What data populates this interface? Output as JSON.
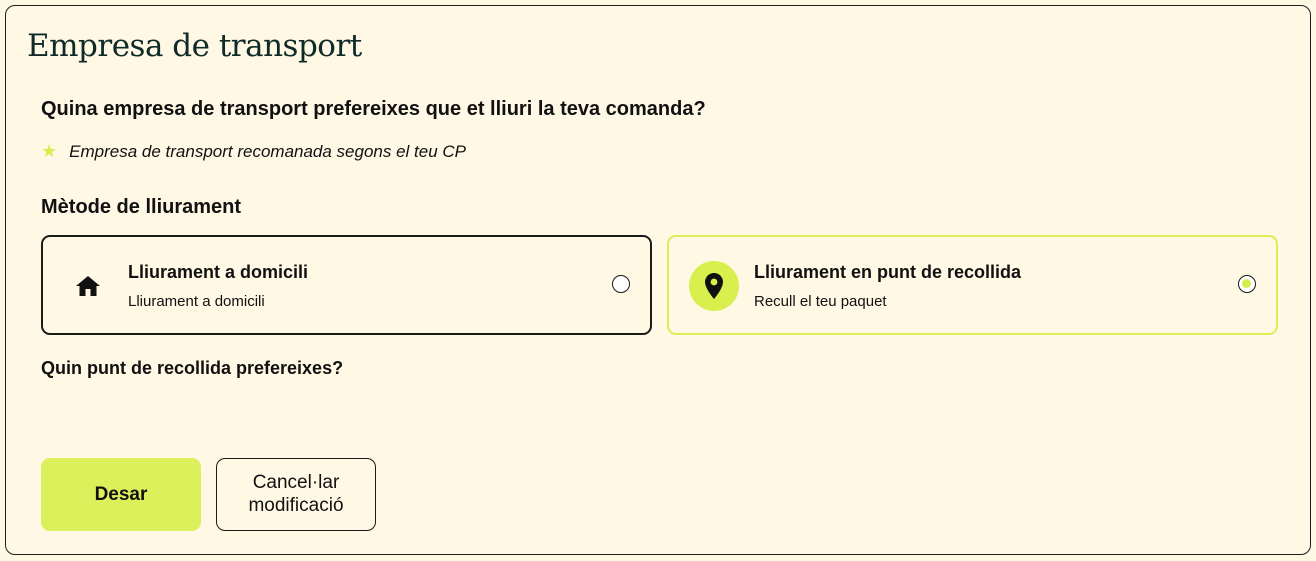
{
  "title": "Empresa de transport",
  "question": "Quina empresa de transport prefereixes que et lliuri la teva comanda?",
  "note": {
    "icon": "star-icon",
    "text": "Empresa de transport recomanada segons el teu CP"
  },
  "method": {
    "label": "Mètode de lliurament",
    "options": [
      {
        "icon": "home-icon",
        "title": "Lliurament a domicili",
        "subtitle": "Lliurament a domicili",
        "selected": false
      },
      {
        "icon": "location-pin-icon",
        "title": "Lliurament en punt de recollida",
        "subtitle": "Recull el teu paquet",
        "selected": true
      }
    ]
  },
  "pickup_question": "Quin punt de recollida prefereixes?",
  "buttons": {
    "save": "Desar",
    "cancel": "Cancel·lar modificació"
  },
  "colors": {
    "accent": "#dbf05a",
    "background": "#fef8e5",
    "title": "#0f2a27"
  }
}
